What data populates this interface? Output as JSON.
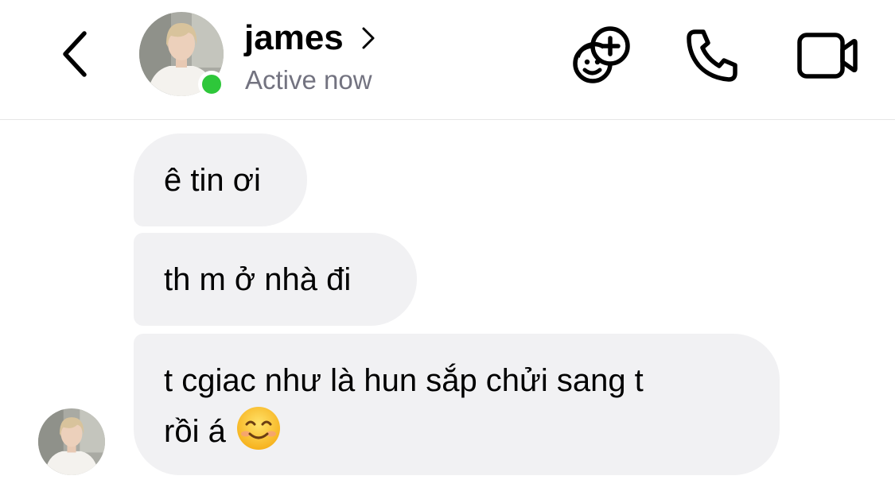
{
  "header": {
    "name": "james",
    "status": "Active now",
    "online_color": "#2ec73a",
    "icons": {
      "back": "chevron-left-icon",
      "profile": "chevron-right-icon",
      "games": "game-controller-add-icon",
      "call": "phone-icon",
      "video": "video-camera-icon"
    }
  },
  "messages": [
    {
      "text": "ê tin ơi"
    },
    {
      "text": "th m ở nhà đi"
    },
    {
      "lines": [
        "t cgiac như là hun sắp chửi sang t",
        "rồi á"
      ],
      "emoji": "smiling-face-icon"
    }
  ],
  "colors": {
    "bubble_bg": "#f1f1f3",
    "status_text": "#737380",
    "divider": "#e6e6e6"
  }
}
